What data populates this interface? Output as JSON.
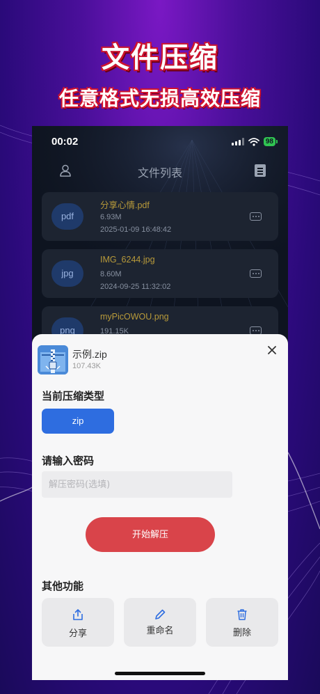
{
  "promo": {
    "title": "文件压缩",
    "subtitle": "任意格式无损高效压缩"
  },
  "status_bar": {
    "time": "00:02",
    "battery": "98"
  },
  "nav": {
    "title": "文件列表"
  },
  "files": [
    {
      "type": "pdf",
      "name": "分享心情.pdf",
      "size": "6.93M",
      "date": "2025-01-09 16:48:42"
    },
    {
      "type": "jpg",
      "name": "IMG_6244.jpg",
      "size": "8.60M",
      "date": "2024-09-25 11:32:02"
    },
    {
      "type": "png",
      "name": "myPicOWOU.png",
      "size": "191.15K",
      "date": ""
    }
  ],
  "sheet": {
    "file_name": "示例.zip",
    "file_size": "107.43K",
    "compress_type_label": "当前压缩类型",
    "compress_type": "zip",
    "password_label": "请输入密码",
    "password_placeholder": "解压密码(选填)",
    "password_value": "",
    "start_button": "开始解压",
    "other_label": "其他功能",
    "actions": {
      "share": "分享",
      "rename": "重命名",
      "delete": "删除"
    }
  },
  "colors": {
    "accent_blue": "#2e6de0",
    "danger_red": "#d9444a",
    "file_name_gold": "#b89a3a"
  }
}
